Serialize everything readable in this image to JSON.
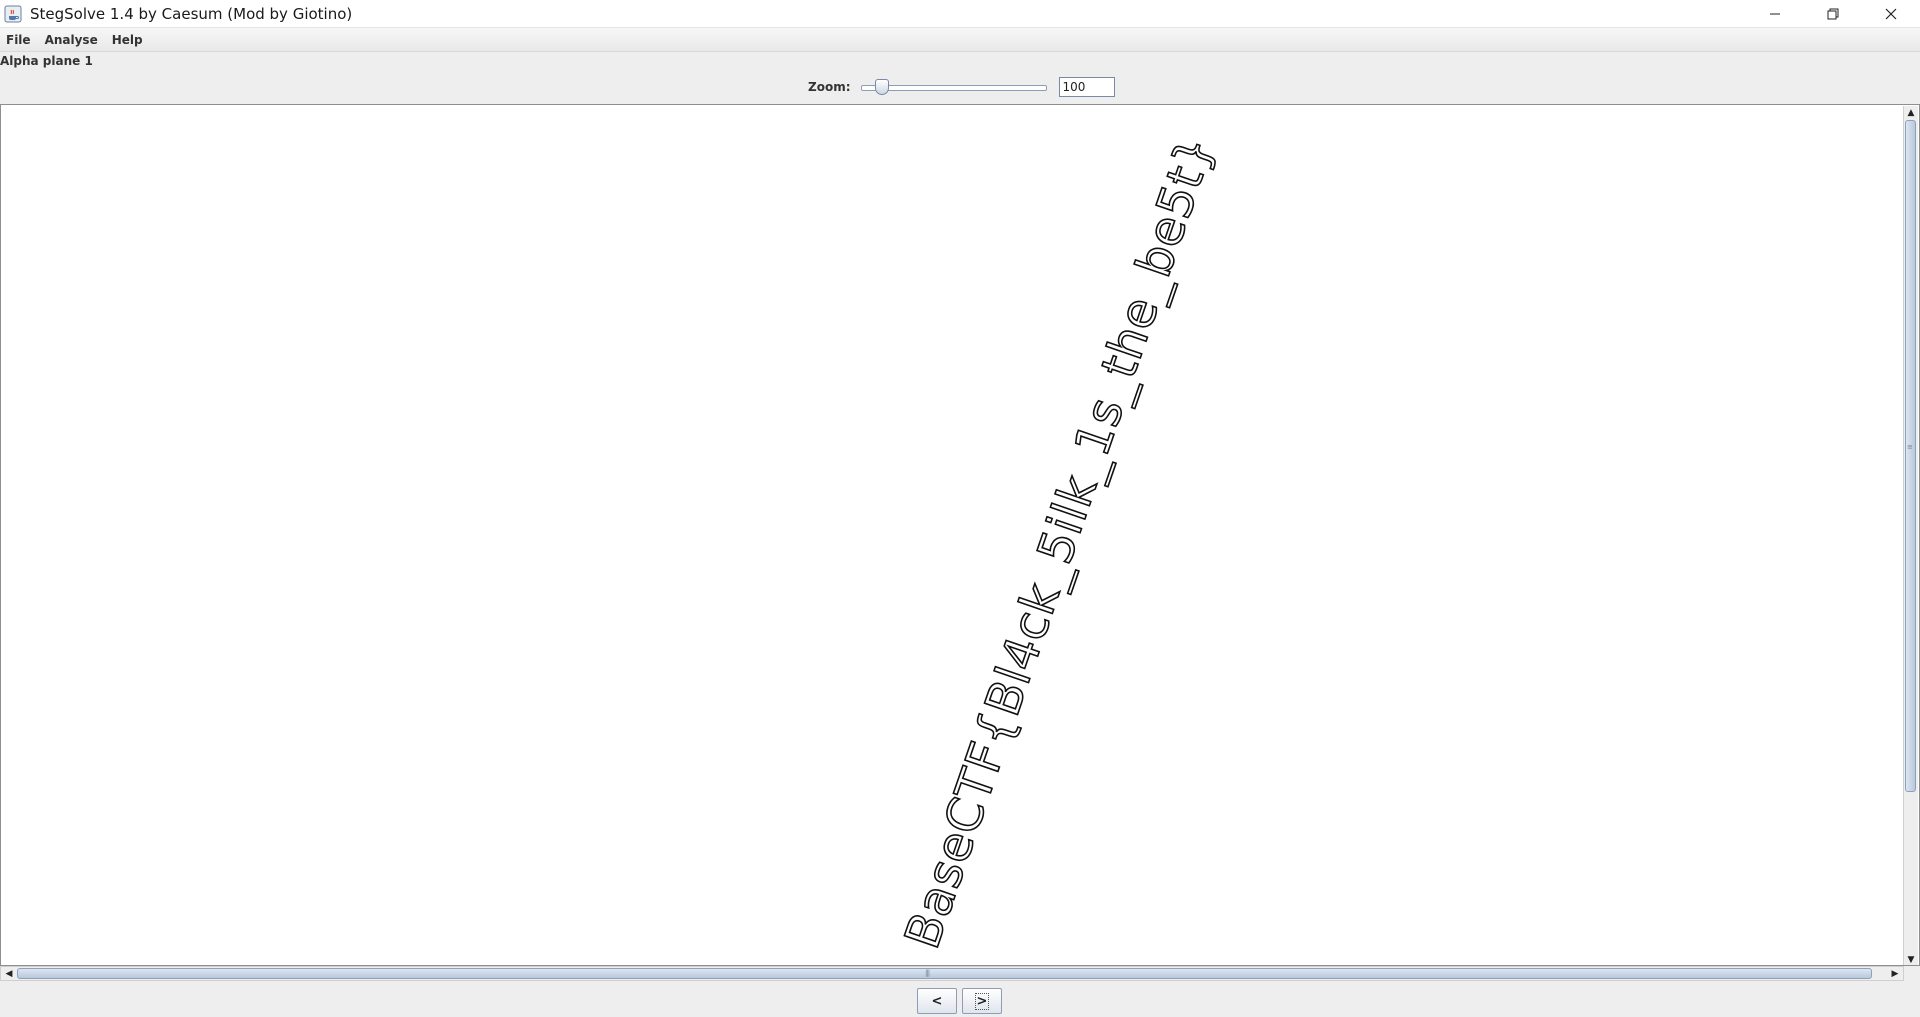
{
  "window": {
    "title": "StegSolve 1.4 by Caesum (Mod by Giotino)",
    "icon": "java-coffee-icon",
    "controls": {
      "minimize_icon": "minimize-icon",
      "maximize_icon": "restore-icon",
      "close_icon": "close-icon"
    }
  },
  "menu": {
    "items": [
      {
        "label": "File"
      },
      {
        "label": "Analyse"
      },
      {
        "label": "Help"
      }
    ]
  },
  "plane": {
    "label": "Alpha plane 1"
  },
  "zoom": {
    "label": "Zoom:",
    "value": "100",
    "slider_fraction": 0.08
  },
  "image": {
    "text": "BaseCTF{Bl4ck_5ilk_1s_the_be5t}"
  },
  "navigation": {
    "prev_label": "<",
    "next_label": ">"
  },
  "colors": {
    "window_bg": "#eeeeee",
    "canvas_bg": "#ffffff",
    "scroll_thumb": "#b9c8dc"
  }
}
